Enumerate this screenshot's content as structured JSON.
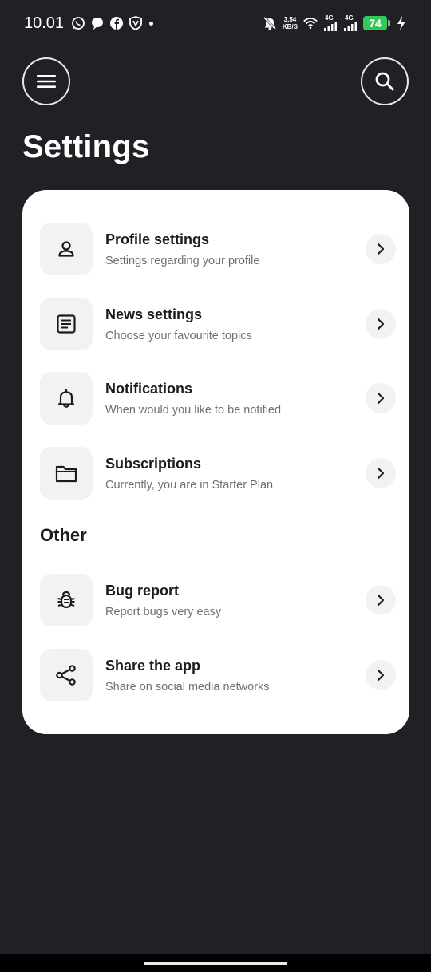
{
  "status_bar": {
    "time": "10.01",
    "net_speed_value": "3,54",
    "net_speed_unit": "KB/S",
    "sig1_label": "4G",
    "sig2_label": "4G",
    "battery": "74"
  },
  "header": {
    "menu_icon": "hamburger-menu-icon",
    "search_icon": "search-icon",
    "title": "Settings"
  },
  "settings": [
    {
      "icon": "user-icon",
      "title": "Profile settings",
      "subtitle": "Settings regarding your profile"
    },
    {
      "icon": "news-icon",
      "title": "News settings",
      "subtitle": "Choose your favourite topics"
    },
    {
      "icon": "bell-icon",
      "title": "Notifications",
      "subtitle": "When would you like to be notified"
    },
    {
      "icon": "folder-icon",
      "title": "Subscriptions",
      "subtitle": "Currently, you are in Starter Plan"
    }
  ],
  "other": {
    "label": "Other",
    "items": [
      {
        "icon": "bug-icon",
        "title": "Bug report",
        "subtitle": "Report bugs very easy"
      },
      {
        "icon": "share-icon",
        "title": "Share the app",
        "subtitle": "Share on social media networks"
      }
    ]
  },
  "colors": {
    "background": "#202124",
    "card": "#ffffff",
    "icon_tile": "#f1f2f4",
    "battery": "#34c759"
  }
}
